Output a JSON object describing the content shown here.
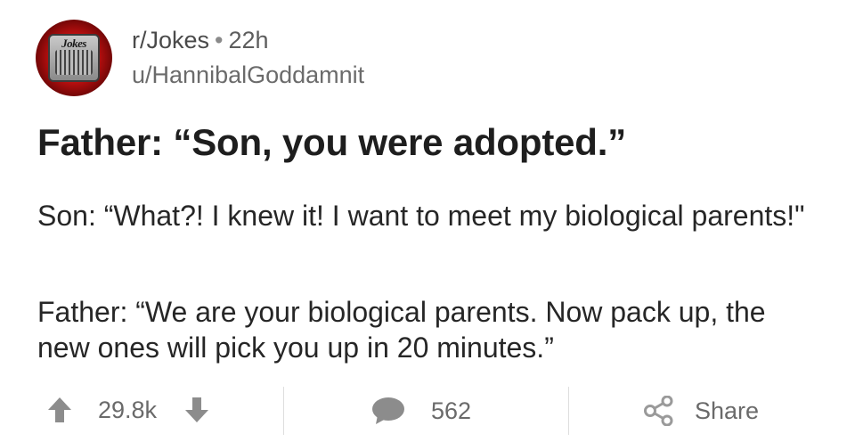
{
  "post": {
    "subreddit": "r/Jokes",
    "separator": "•",
    "age": "22h",
    "author": "u/HannibalGoddamnit",
    "avatar_text": "Jokes",
    "title": "Father: “Son, you were adopted.”",
    "body": [
      "Son: “What?! I knew it! I want to meet my biological parents!\"",
      "Father: “We are your biological parents. Now pack up, the new ones will pick you up in 20 minutes.”"
    ]
  },
  "actions": {
    "score": "29.8k",
    "comments": "562",
    "share_label": "Share"
  },
  "colors": {
    "text_primary": "#1e1e1e",
    "text_secondary": "#6a6a6a",
    "icon": "#8c8c8c",
    "avatar_red": "#c01313",
    "divider": "#dedede"
  },
  "icons": {
    "upvote": "arrow-up-icon",
    "downvote": "arrow-down-icon",
    "comment": "speech-bubble-icon",
    "share": "share-icon"
  }
}
